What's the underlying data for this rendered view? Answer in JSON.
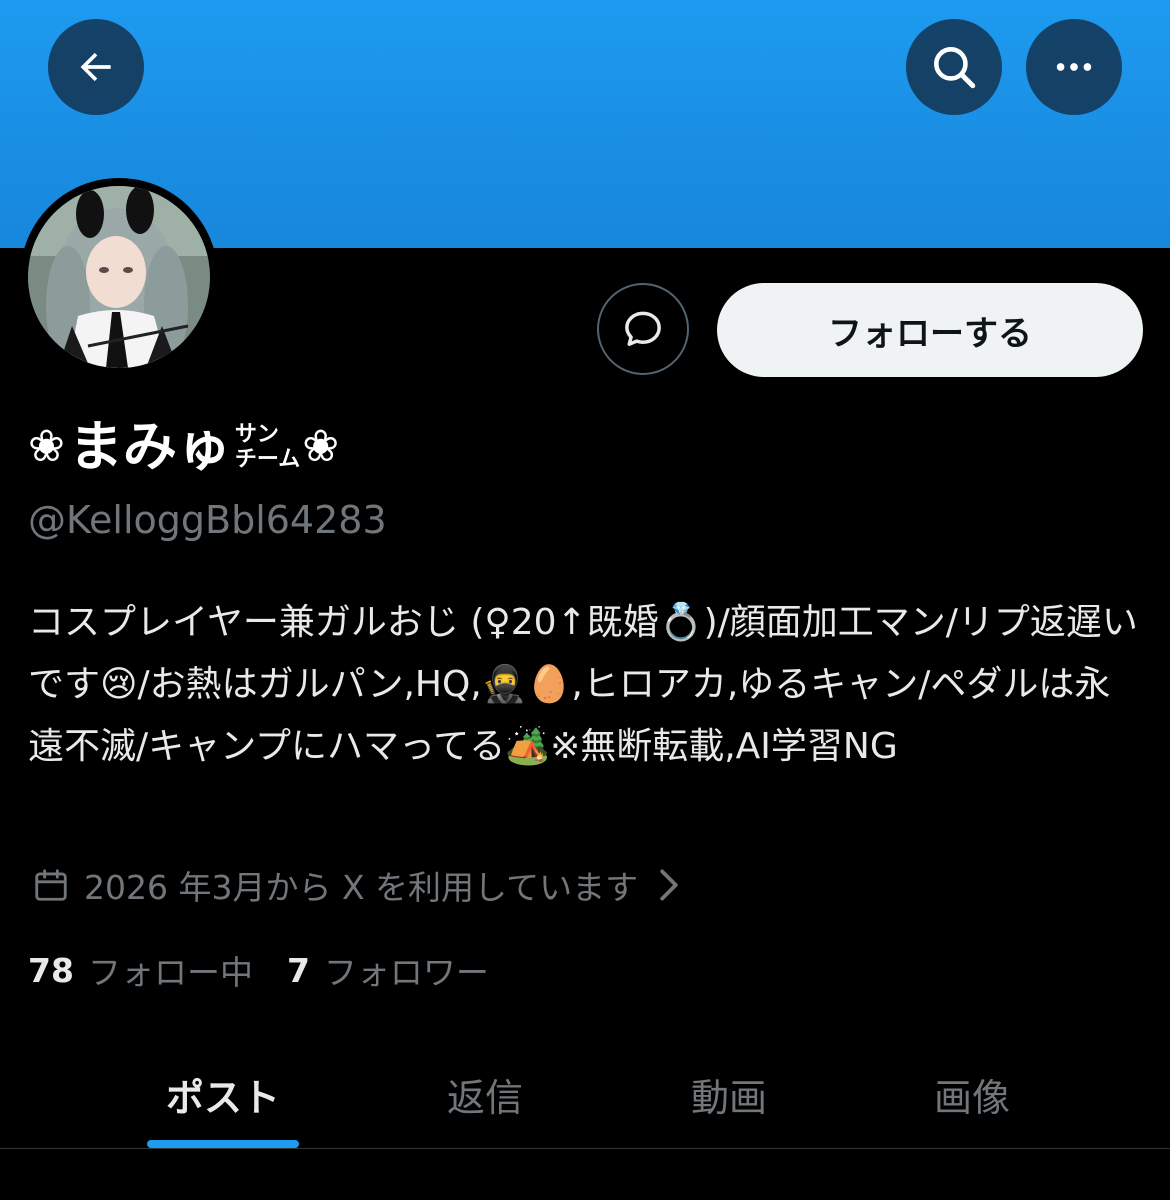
{
  "header": {
    "back_icon": "arrow-left-icon",
    "search_icon": "search-icon",
    "more_icon": "more-horizontal-icon",
    "banner_color": "#1d9bf0"
  },
  "profile": {
    "display_name_flower": "❀",
    "display_name": "まみゅ",
    "display_name_ruby_top": "サン",
    "display_name_ruby_bottom": "チーム",
    "handle": "@KelloggBbl64283",
    "bio": "コスプレイヤー兼ガルおじ (♀20↑既婚💍)/顔面加工マン/リプ返遅いです😢/お熱はガルパン,HQ,🥷🥚,ヒロアカ,ゆるキャン/ペダルは永遠不滅/キャンプにハマってる🏕️※無断転載,AI学習NG",
    "joined": "2026 年3月から X を利用しています",
    "following_count": "78",
    "following_label": "フォロー中",
    "followers_count": "7",
    "followers_label": "フォロワー"
  },
  "actions": {
    "message_icon": "message-bubble-icon",
    "follow_label": "フォローする"
  },
  "tabs": [
    {
      "label": "ポスト",
      "active": true
    },
    {
      "label": "返信",
      "active": false
    },
    {
      "label": "動画",
      "active": false
    },
    {
      "label": "画像",
      "active": false
    }
  ],
  "colors": {
    "accent": "#1d9bf0",
    "background": "#000000",
    "secondary_text": "#71767b"
  }
}
